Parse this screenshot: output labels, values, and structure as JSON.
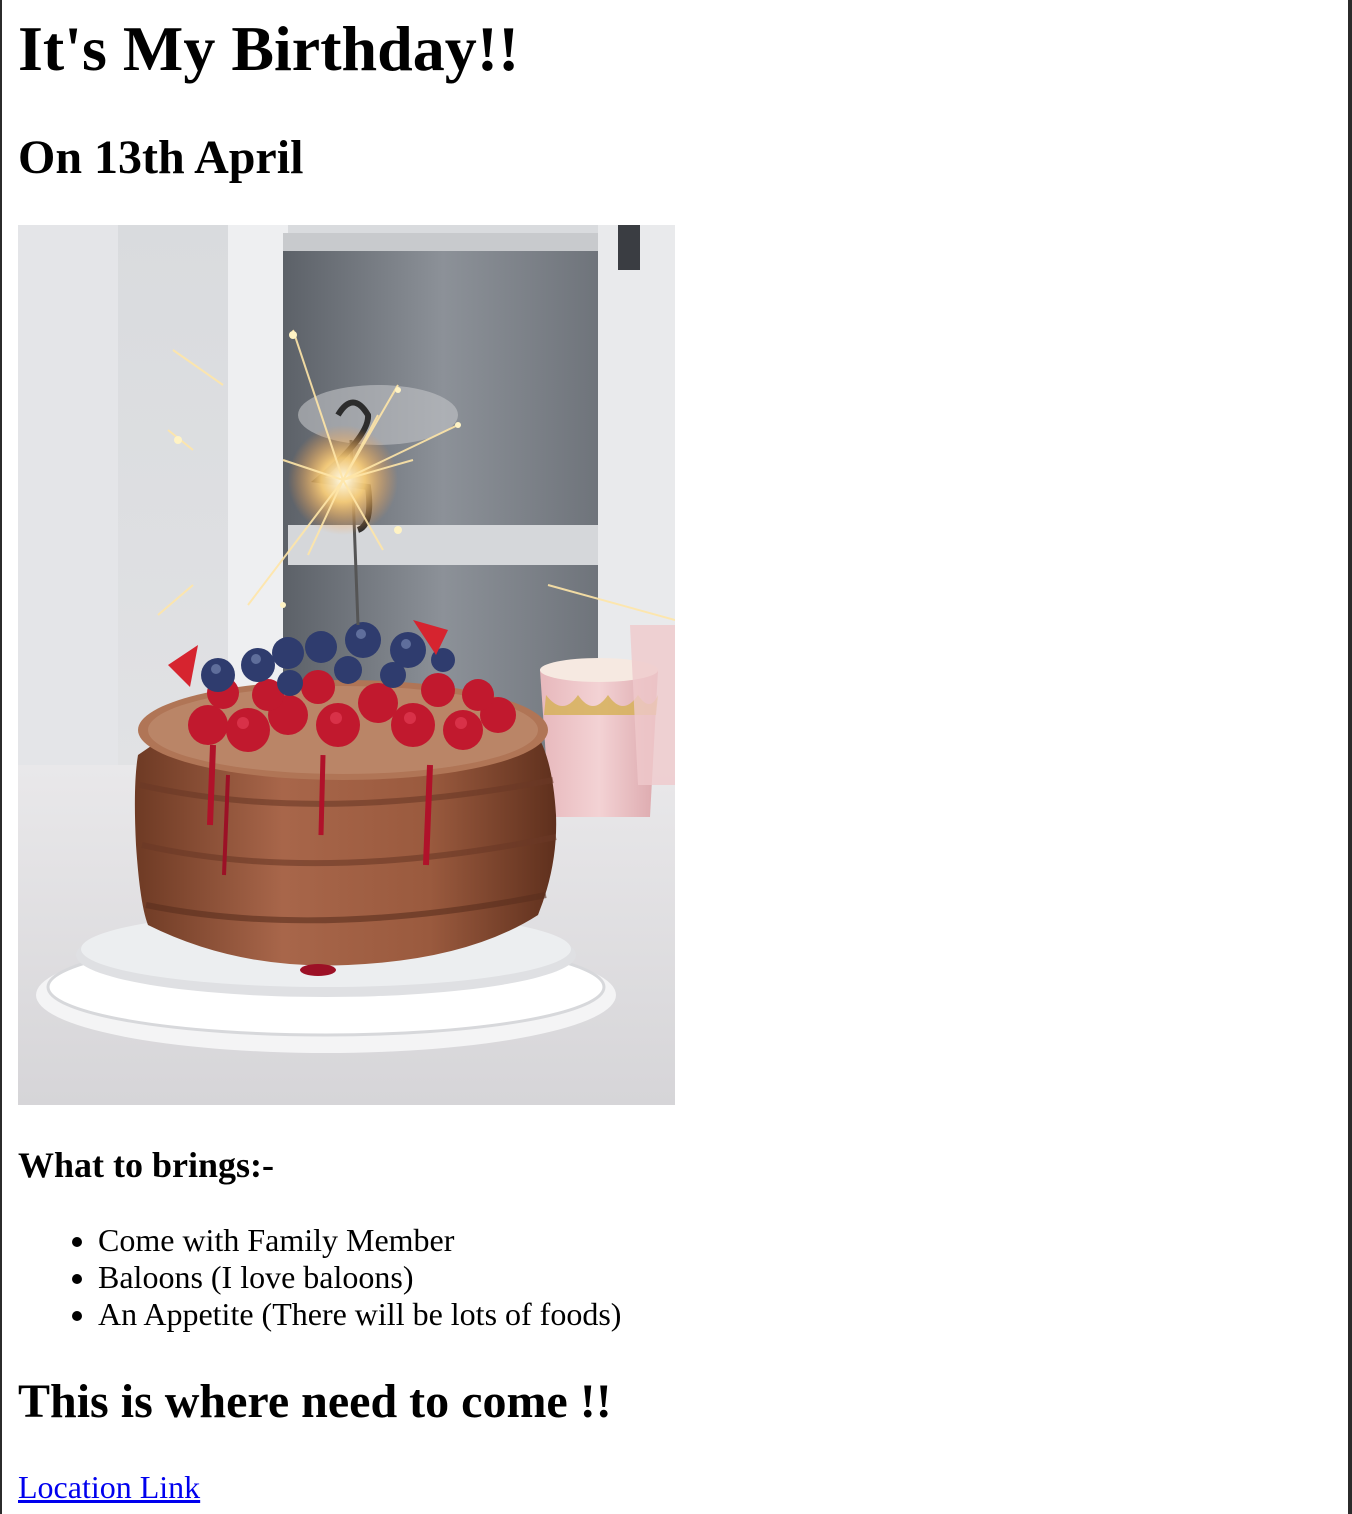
{
  "page": {
    "title": "It's My Birthday!!",
    "date_heading": "On 13th April",
    "photo": {
      "subject": "chocolate birthday cake with berries and a lit number sparkler"
    },
    "bring_heading": "What to brings:-",
    "bring_items": [
      {
        "label": "Come with Family Member"
      },
      {
        "label": "Baloons (I love baloons)"
      },
      {
        "label": "An Appetite (There will be lots of foods)"
      }
    ],
    "where_heading": "This is where need to come !!",
    "location_link": "Location Link"
  },
  "colors": {
    "link": "#0000ee",
    "text": "#000000",
    "background": "#ffffff"
  }
}
